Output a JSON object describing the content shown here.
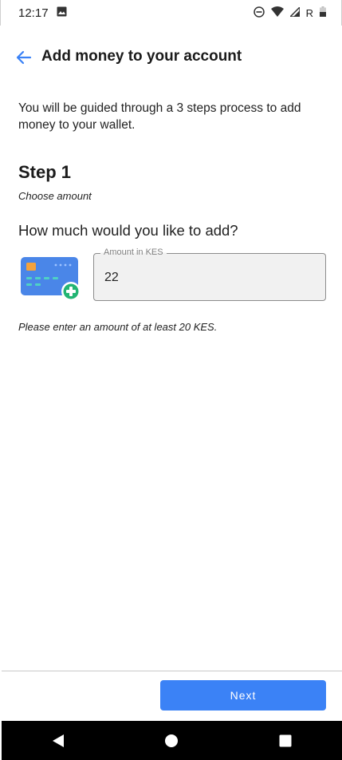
{
  "status_bar": {
    "time": "12:17",
    "network_label": "R"
  },
  "header": {
    "title": "Add money to your account"
  },
  "intro": {
    "text": "You will be guided through a 3 steps process to add money to your wallet."
  },
  "step": {
    "title": "Step 1",
    "subtitle": "Choose amount"
  },
  "question": "How much would you like to add?",
  "amount_field": {
    "label": "Amount in KES",
    "value": "22"
  },
  "hint": "Please enter an amount of at least 20 KES.",
  "actions": {
    "next_label": "Next"
  },
  "colors": {
    "accent": "#3b82f6",
    "card_blue": "#4a86e8",
    "plus_green": "#22b573",
    "chip_orange": "#f4a23c"
  },
  "icons": {
    "status": [
      "image-icon",
      "dnd-icon",
      "wifi-icon",
      "signal-icon",
      "battery-icon"
    ],
    "header": "back-arrow-icon",
    "nav": [
      "nav-back-icon",
      "nav-home-icon",
      "nav-recents-icon"
    ]
  }
}
